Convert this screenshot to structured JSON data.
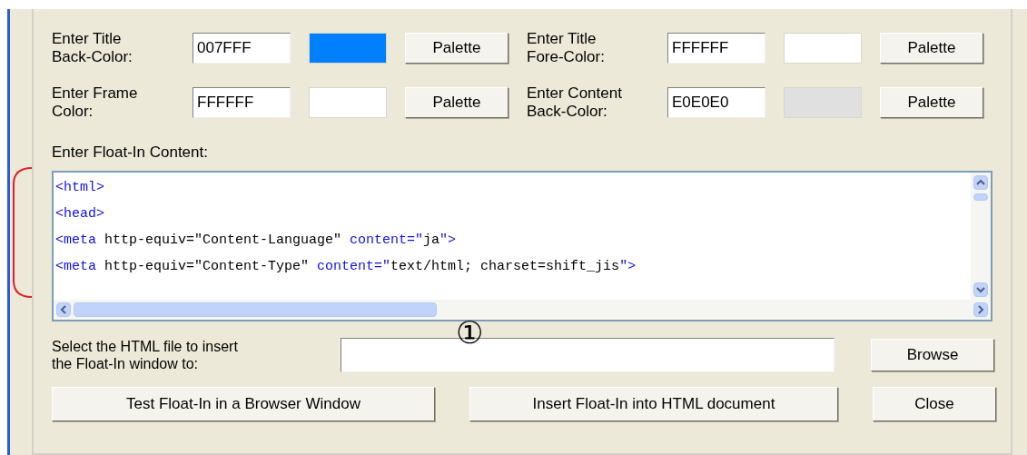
{
  "color_settings": [
    {
      "label_lines": [
        "Enter Title",
        "Back-Color:"
      ],
      "value": "007FFF",
      "color": "#007fff",
      "button": "Palette"
    },
    {
      "label_lines": [
        "Enter Title",
        "Fore-Color:"
      ],
      "value": "FFFFFF",
      "color": "#ffffff",
      "button": "Palette"
    },
    {
      "label_lines": [
        "Enter Frame",
        "Color:"
      ],
      "value": "FFFFFF",
      "color": "#ffffff",
      "button": "Palette"
    },
    {
      "label_lines": [
        "Enter Content",
        "Back-Color:"
      ],
      "value": "E0E0E0",
      "color": "#e0e0e0",
      "button": "Palette"
    }
  ],
  "content_editor": {
    "label": "Enter Float-In Content:",
    "lines": [
      [
        {
          "kind": "tag",
          "text": "<html>"
        }
      ],
      [
        {
          "kind": "tag",
          "text": "<head>"
        }
      ],
      [
        {
          "kind": "tag",
          "text": "<meta"
        },
        {
          "kind": "plain",
          "text": " http-equiv=\"Content-Language\" "
        },
        {
          "kind": "tag",
          "text": "content=\""
        },
        {
          "kind": "plain",
          "text": "ja"
        },
        {
          "kind": "tag",
          "text": "\">"
        }
      ],
      [
        {
          "kind": "tag",
          "text": "<meta"
        },
        {
          "kind": "plain",
          "text": " http-equiv=\"Content-Type\" "
        },
        {
          "kind": "tag",
          "text": "content=\""
        },
        {
          "kind": "plain",
          "text": "text/html; charset=shift_jis"
        },
        {
          "kind": "tag",
          "text": "\">"
        }
      ]
    ]
  },
  "file_select": {
    "label_lines": [
      "Select the HTML file to insert",
      "the Float-In window to:"
    ],
    "button": "Browse"
  },
  "annotation": "①",
  "buttons": [
    "Test Float-In in a Browser Window",
    "Insert Float-In into HTML document",
    "Close"
  ]
}
